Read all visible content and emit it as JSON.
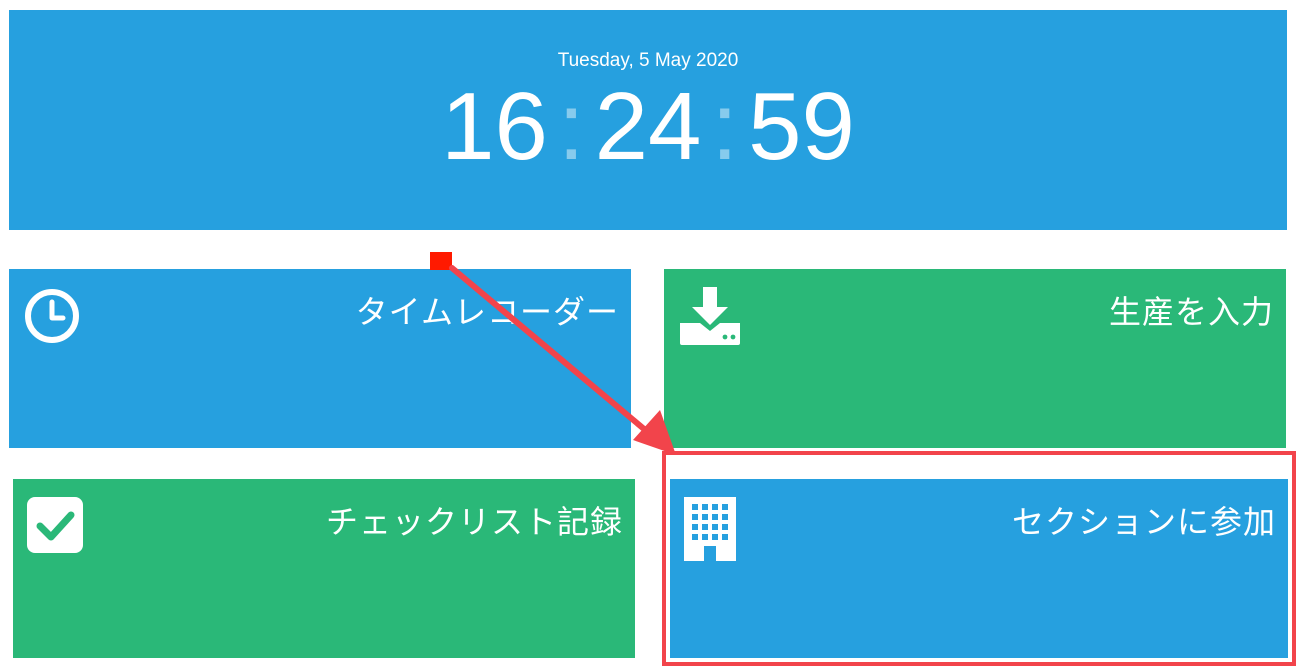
{
  "header": {
    "date": "Tuesday, 5 May 2020",
    "hours": "16",
    "minutes": "24",
    "seconds": "59",
    "separator": ":"
  },
  "tiles": [
    {
      "label": "タイムレコーダー",
      "icon": "clock-icon",
      "color": "#26a0df"
    },
    {
      "label": "生産を入力",
      "icon": "download-icon",
      "color": "#2ab878"
    },
    {
      "label": "チェックリスト記録",
      "icon": "checkbox-icon",
      "color": "#2ab878"
    },
    {
      "label": "セクションに参加",
      "icon": "building-icon",
      "color": "#26a0df"
    }
  ],
  "annotation": {
    "highlight_color": "#f2444b",
    "marker_color": "#ff1a00"
  }
}
